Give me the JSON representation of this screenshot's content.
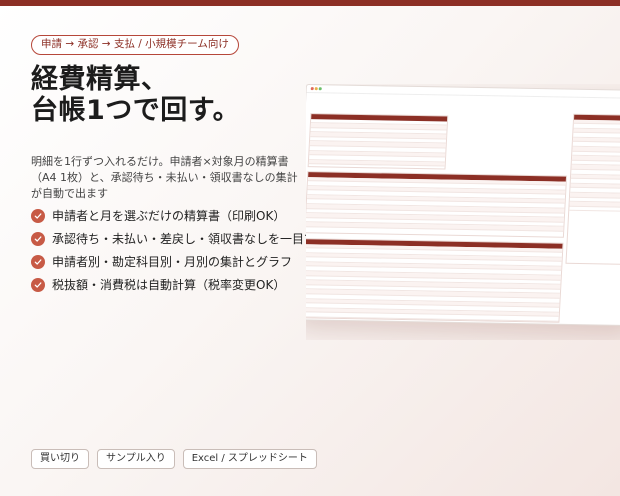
{
  "flow_pill": "申請 → 承認 → 支払 / 小規模チーム向け",
  "headline": {
    "line1": "経費精算、",
    "line2": "台帳1つで回す。"
  },
  "description": "明細を1行ずつ入れるだけ。申請者×対象月の精算書（A4 1枚）と、承認待ち・未払い・領収書なしの集計が自動で出ます",
  "features": [
    "申請者と月を選ぶだけの精算書（印刷OK）",
    "承認待ち・未払い・差戻し・領収書なしを一目で",
    "申請者別・勘定科目別・月別の集計とグラフ",
    "税抜額・消費税は自動計算（税率変更OK）"
  ],
  "tags": [
    "買い切り",
    "サンプル入り",
    "Excel / スプレッドシート"
  ],
  "colors": {
    "accent": "#8c2f25",
    "check": "#c75a45"
  }
}
